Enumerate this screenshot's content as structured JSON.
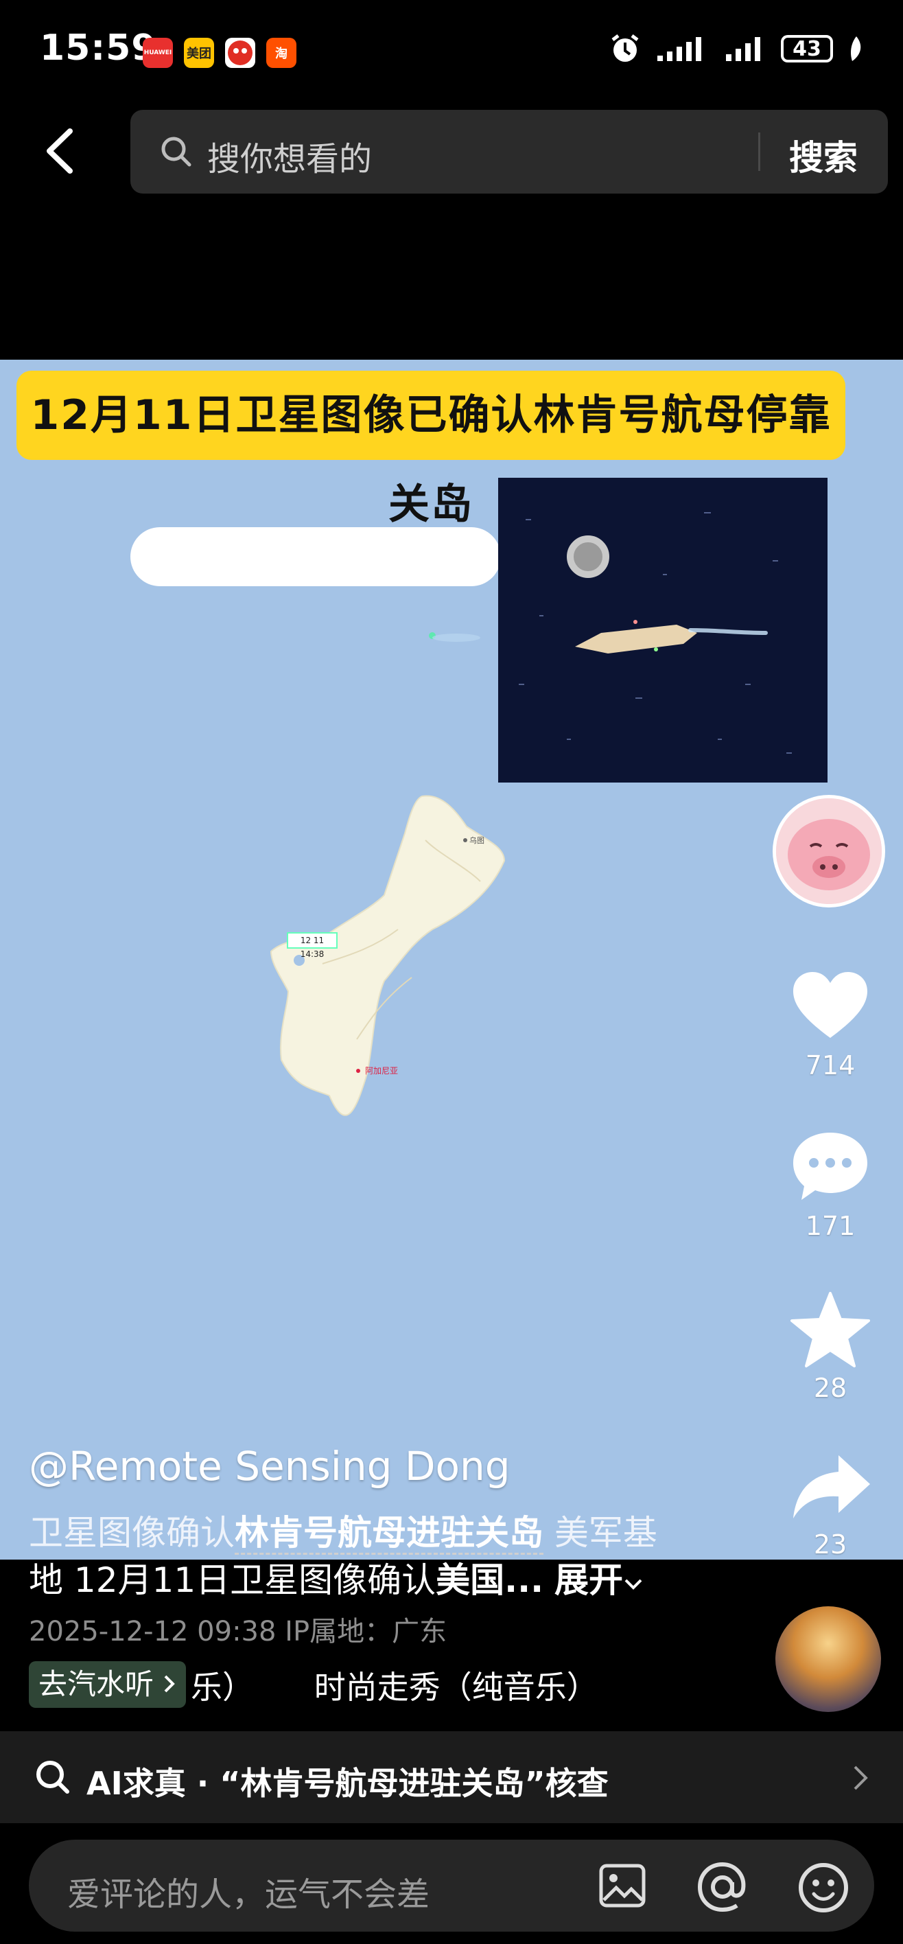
{
  "status_bar": {
    "time": "15:59",
    "apps": [
      {
        "name": "huawei-app-icon",
        "label": "HUAWEI",
        "color": "#e8302e"
      },
      {
        "name": "meituan-app-icon",
        "label": "美团",
        "color": "#ffc300"
      },
      {
        "name": "pinduoduo-app-icon",
        "label": "",
        "color": "#e02e24"
      },
      {
        "name": "taobao-app-icon",
        "label": "淘",
        "color": "#ff5000"
      }
    ],
    "battery": "43"
  },
  "top_bar": {
    "search_placeholder": "搜你想看的",
    "search_button": "搜索"
  },
  "video": {
    "banner_text": "12月11日卫星图像已确认林肯号航母停靠关岛",
    "island_tag": "12 11 14:38"
  },
  "actions": {
    "likes": "714",
    "comments": "171",
    "favorites": "28",
    "shares": "23"
  },
  "caption": {
    "author": "@Remote Sensing Dong",
    "line1_prefix": "卫星图像确认",
    "line1_highlight": "林肯号航母进驻关岛",
    "line1_suffix": " 美军基",
    "line2_prefix": "地 12月11日卫星图像确认",
    "line2_bold": "美国...",
    "expand_label": "展开",
    "meta": "2025-12-12 09:38  IP属地：广东",
    "music_chip": "去汽水听",
    "music_title": "乐）      时尚走秀（纯音乐）"
  },
  "ai_bar": {
    "text": "AI求真 · “林肯号航母进驻关岛”核查"
  },
  "comment_bar": {
    "placeholder": "爱评论的人，运气不会差"
  },
  "colors": {
    "video_bg": "#a4c3e6",
    "banner_bg": "#ffd51f",
    "island": "#f6f3e0"
  }
}
